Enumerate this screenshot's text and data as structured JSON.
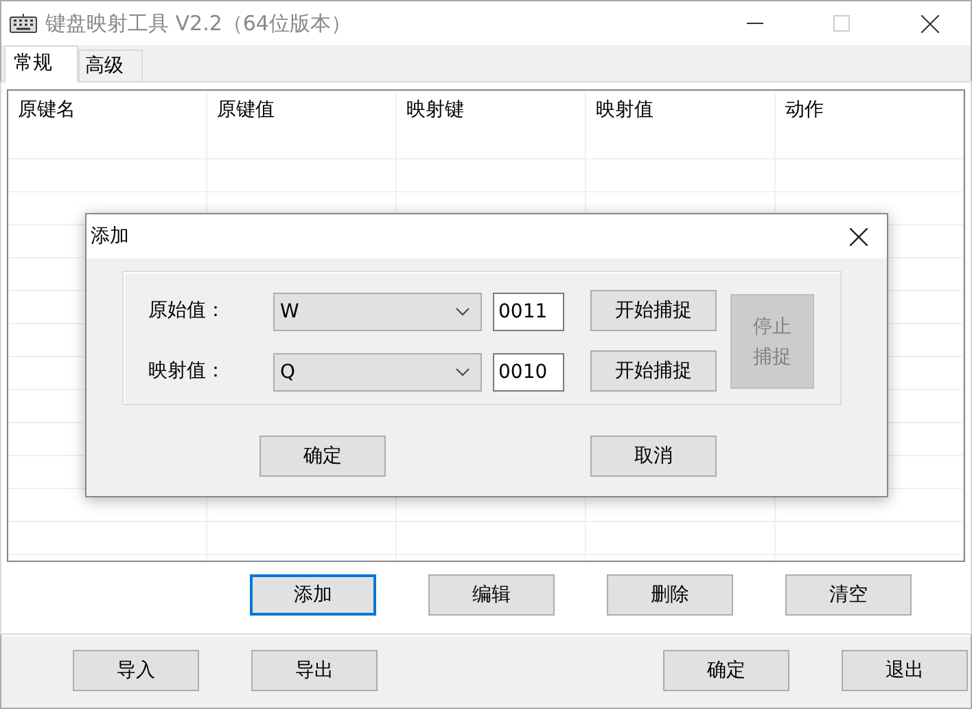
{
  "window": {
    "title": "键盘映射工具 V2.2（64位版本）"
  },
  "tabs": [
    {
      "label": "常规",
      "selected": true
    },
    {
      "label": "高级",
      "selected": false
    }
  ],
  "table": {
    "columns": [
      "原键名",
      "原键值",
      "映射键",
      "映射值",
      "动作"
    ]
  },
  "list_buttons": [
    {
      "label": "添加",
      "focused": true
    },
    {
      "label": "编辑",
      "focused": false
    },
    {
      "label": "删除",
      "focused": false
    },
    {
      "label": "清空",
      "focused": false
    }
  ],
  "bottom_bar": {
    "left_buttons": [
      "导入",
      "导出"
    ],
    "right_buttons": [
      "确定",
      "退出"
    ]
  },
  "dialog": {
    "title": "添加",
    "fields": [
      {
        "label": "原始值：",
        "key": "W",
        "code": "0011",
        "button": "开始捕捉"
      },
      {
        "label": "映射值：",
        "key": "Q",
        "code": "0010",
        "button": "开始捕捉"
      }
    ],
    "stop_button": {
      "label": "停止捕捉",
      "disabled": true
    },
    "buttons": [
      "确定",
      "取消"
    ]
  }
}
